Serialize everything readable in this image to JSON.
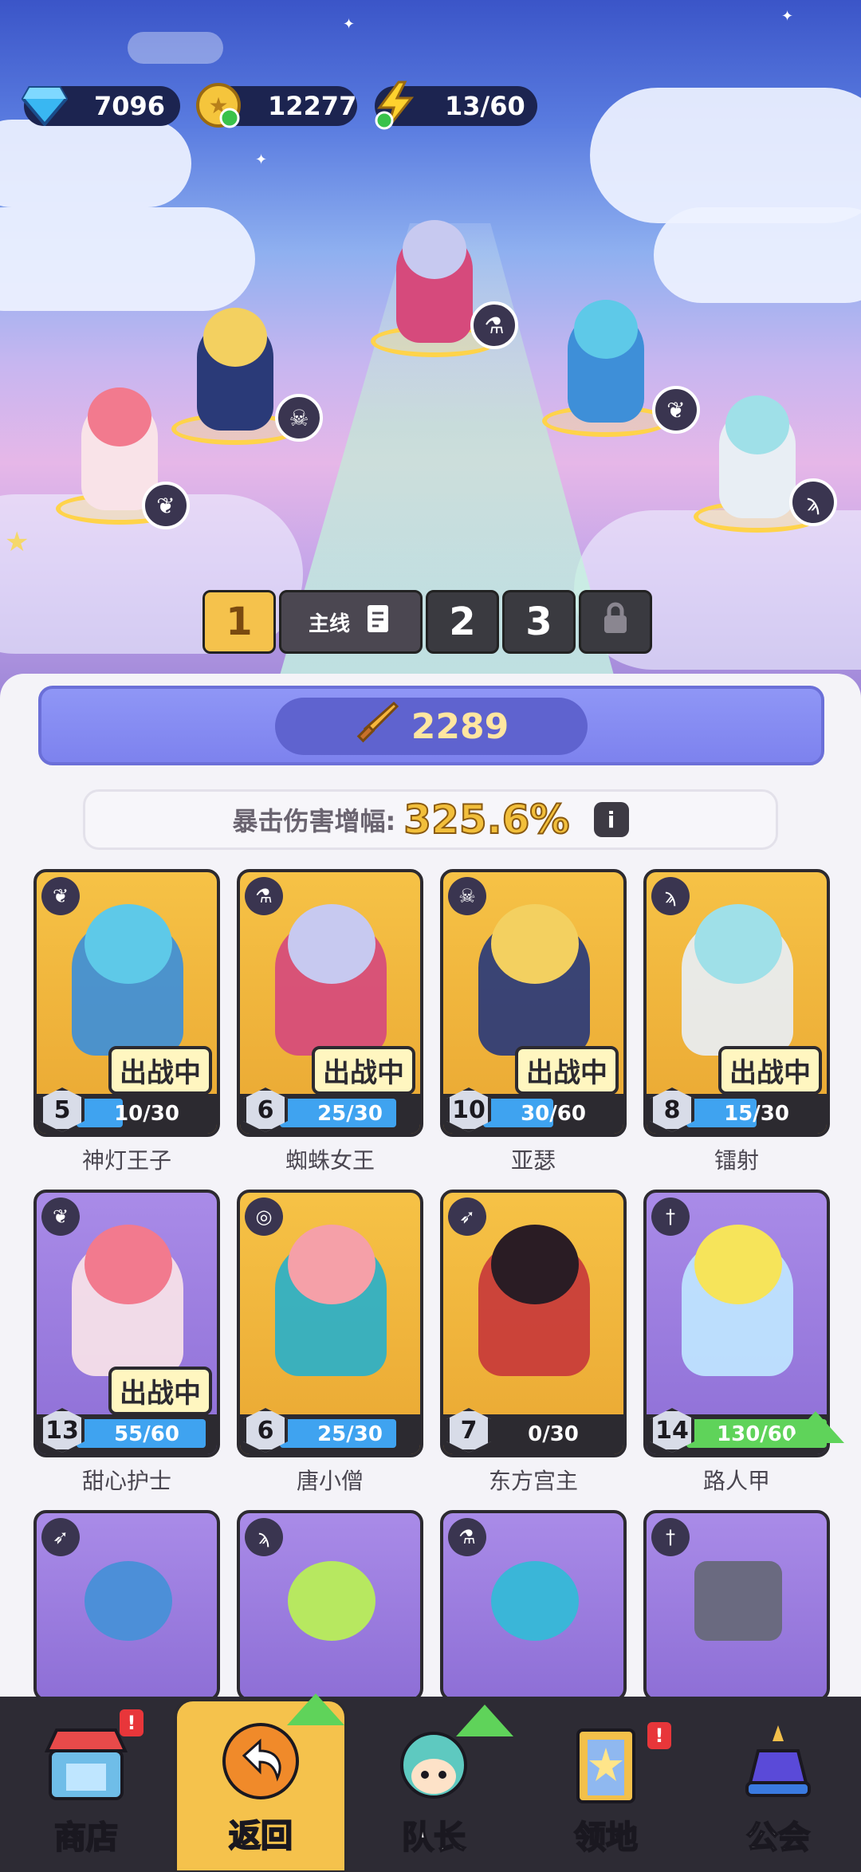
{
  "currencies": {
    "gems": "7096",
    "coins": "12277",
    "energy": "13/60"
  },
  "team_tabs": {
    "tab1": "1",
    "mainline": "主线",
    "tab2": "2",
    "tab3": "3"
  },
  "power": "2289",
  "crit": {
    "label": "暴击伤害增幅:",
    "value": "325.6%"
  },
  "heroes": [
    {
      "name": "神灯王子",
      "level": "5",
      "progress": "10/30",
      "ratio": 0.33,
      "status": "出战中",
      "card": "gold",
      "class_icon": "wings-icon"
    },
    {
      "name": "蜘蛛女王",
      "level": "6",
      "progress": "25/30",
      "ratio": 0.83,
      "status": "出战中",
      "card": "gold",
      "class_icon": "potion-icon"
    },
    {
      "name": "亚瑟",
      "level": "10",
      "progress": "30/60",
      "ratio": 0.5,
      "status": "出战中",
      "card": "gold",
      "class_icon": "skull-icon"
    },
    {
      "name": "镭射",
      "level": "8",
      "progress": "15/30",
      "ratio": 0.5,
      "status": "出战中",
      "card": "gold",
      "class_icon": "staff-icon"
    },
    {
      "name": "甜心护士",
      "level": "13",
      "progress": "55/60",
      "ratio": 0.92,
      "status": "出战中",
      "card": "purple",
      "class_icon": "wings-icon"
    },
    {
      "name": "唐小僧",
      "level": "6",
      "progress": "25/30",
      "ratio": 0.83,
      "status": "",
      "card": "gold",
      "class_icon": "swirl-icon"
    },
    {
      "name": "东方宫主",
      "level": "7",
      "progress": "0/30",
      "ratio": 0,
      "status": "",
      "card": "gold",
      "class_icon": "bow-icon"
    },
    {
      "name": "路人甲",
      "level": "14",
      "progress": "130/60",
      "ratio": 1,
      "status": "",
      "card": "purple",
      "class_icon": "sword-icon"
    }
  ],
  "nav": {
    "shop": "商店",
    "back": "返回",
    "captain": "队长",
    "territory": "领地",
    "guild": "公会",
    "alert": "!"
  },
  "colors": {
    "accent_gold": "#f5c24c",
    "progress_blue": "#3fa3f0",
    "progress_green": "#5fd35a",
    "dark": "#2c2a30"
  }
}
